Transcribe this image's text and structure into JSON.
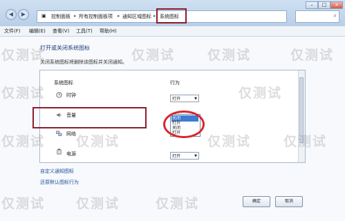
{
  "address_bar": {
    "crumbs": [
      "控制面板",
      "所有控制面板项",
      "通知区域图标",
      "系统图标"
    ]
  },
  "menubar": {
    "items": [
      "文件(F)",
      "编辑(E)",
      "查看(V)",
      "工具(T)",
      "帮助(H)"
    ]
  },
  "main": {
    "title": "打开或关闭系统图标",
    "description": "关闭系统图标将删除该图标并关闭通知。",
    "table": {
      "col_icon": "系统图标",
      "col_behavior": "行为",
      "rows": [
        {
          "label": "时钟",
          "icon": "clock-icon",
          "value": "打开"
        },
        {
          "label": "音量",
          "icon": "speaker-icon",
          "value": "关闭"
        },
        {
          "label": "网络",
          "icon": "network-icon",
          "value": ""
        },
        {
          "label": "电源",
          "icon": "power-icon",
          "value": "打开"
        }
      ],
      "dropdown_options": [
        "关闭",
        "打开",
        "关闭",
        "打开"
      ],
      "dropdown_selected_index": 0
    },
    "link_customize": "自定义通知图标",
    "link_restore": "还原默认图标行为"
  },
  "footer": {
    "ok_label": "确定",
    "cancel_label": "取消"
  },
  "watermark": "仅测试",
  "colors": {
    "highlight_box": "#8a1d2a",
    "circle": "#d9262c",
    "selection": "#3d7cd0",
    "link": "#1d4f9b"
  }
}
